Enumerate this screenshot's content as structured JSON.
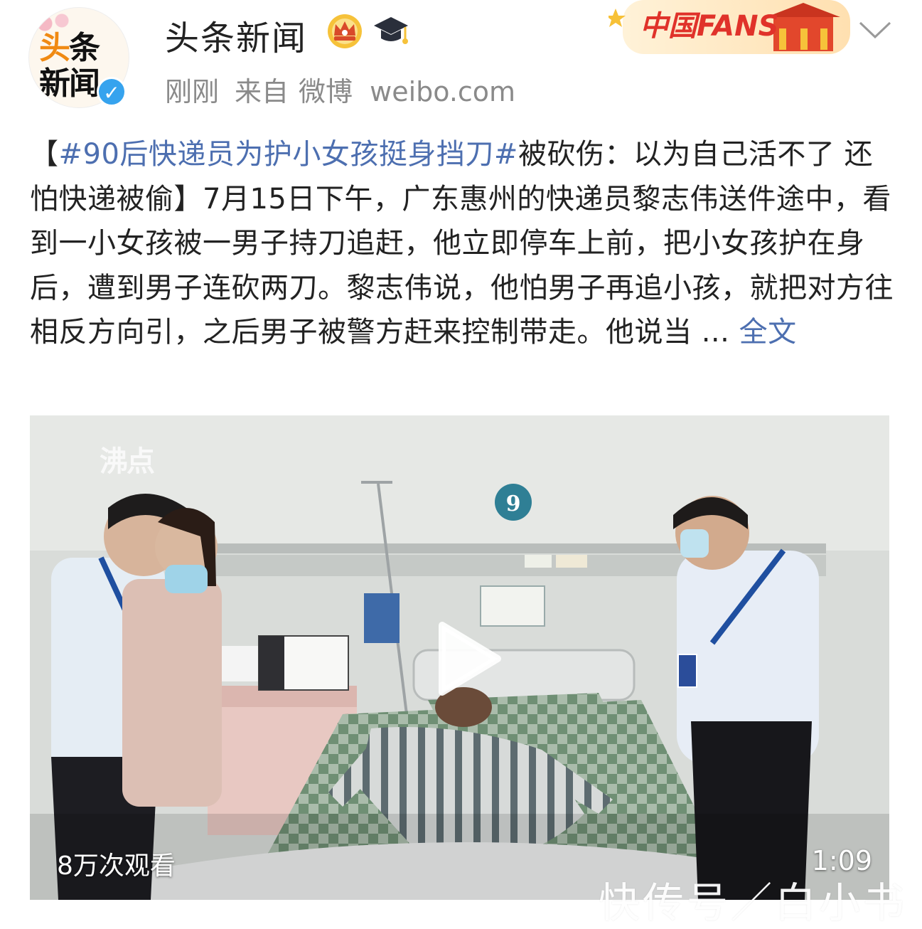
{
  "header": {
    "avatar_text_line1_first": "头",
    "avatar_text_line1_rest": "条",
    "avatar_text_line2": "新闻",
    "verified_mark": "✓",
    "account_name": "头条新闻",
    "time": "刚刚",
    "source_prefix": "来自",
    "source": "微博 weibo.com",
    "badges": [
      "crown-badge-icon",
      "graduation-cap-icon"
    ],
    "fans_banner_text": "中国FANS"
  },
  "post": {
    "open_bracket": "【",
    "hashtag": "#90后快递员为护小女孩挺身挡刀#",
    "headline_rest": "被砍伤：以为自己活不了 还怕快递被偷",
    "close_bracket": "】",
    "body": "7月15日下午，广东惠州的快递员黎志伟送件途中，看到一小女孩被一男子持刀追赶，他立即停车上前，把小女孩护在身后，遭到男子连砍两刀。黎志伟说，他怕男子再追小孩，就把对方往相反方向引，之后男子被警方赶来控制带走。他说当 ... ",
    "more_link": "全文"
  },
  "video": {
    "watermark": "沸点",
    "bed_number": "9",
    "views": "8万次观看",
    "duration": "1:09"
  },
  "overlay_watermark": "快传号／白小书",
  "colors": {
    "link": "#4d6fb0",
    "verified": "#36a3ee",
    "meta": "#8a8a8a"
  }
}
